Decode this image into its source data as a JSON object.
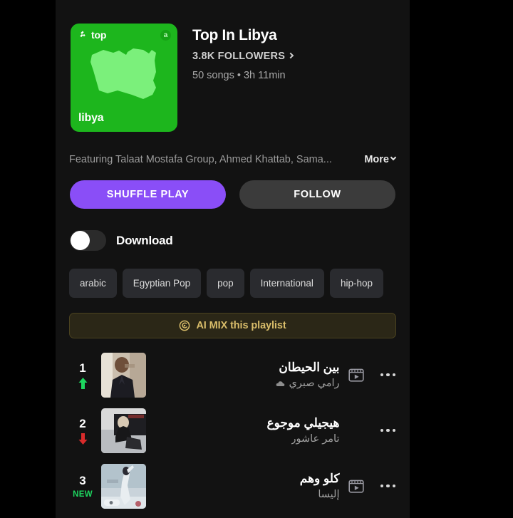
{
  "playlist": {
    "cover": {
      "top_label": "top",
      "badge_label": "a",
      "country_name": "libya",
      "bg_color": "#1DB61D",
      "map_color": "#7BF07B"
    },
    "title": "Top In Libya",
    "followers": "3.8K FOLLOWERS",
    "stats": "50 songs • 3h 11min",
    "featuring": "Featuring Talaat Mostafa Group, Ahmed Khattab, Sama...",
    "more_label": "More"
  },
  "actions": {
    "shuffle_label": "SHUFFLE PLAY",
    "shuffle_color": "#8A4EF7",
    "follow_label": "FOLLOW",
    "follow_color": "#3b3b3b"
  },
  "download": {
    "label": "Download",
    "enabled": false
  },
  "tags": [
    {
      "label": "arabic"
    },
    {
      "label": "Egyptian Pop"
    },
    {
      "label": "pop"
    },
    {
      "label": "International"
    },
    {
      "label": "hip-hop"
    }
  ],
  "ai_mix": {
    "label": "AI MIX this playlist",
    "accent_color": "#d9bd6a"
  },
  "tracks": [
    {
      "rank": "1",
      "trend": "up",
      "trend_color": "#1DD65F",
      "title": "بين الحيطان",
      "artist": "رامي صبري",
      "has_video": true,
      "has_artist_badge": true,
      "more_label": "..."
    },
    {
      "rank": "2",
      "trend": "down",
      "trend_color": "#D92B2B",
      "title": "هيجيلي موجوع",
      "artist": "تامر عاشور",
      "has_video": false,
      "has_artist_badge": false,
      "more_label": "..."
    },
    {
      "rank": "3",
      "trend": "new",
      "trend_label": "NEW",
      "trend_color": "#1DD65F",
      "title": "كلو وهم",
      "artist": "إليسا",
      "has_video": true,
      "has_artist_badge": false,
      "more_label": "..."
    }
  ]
}
